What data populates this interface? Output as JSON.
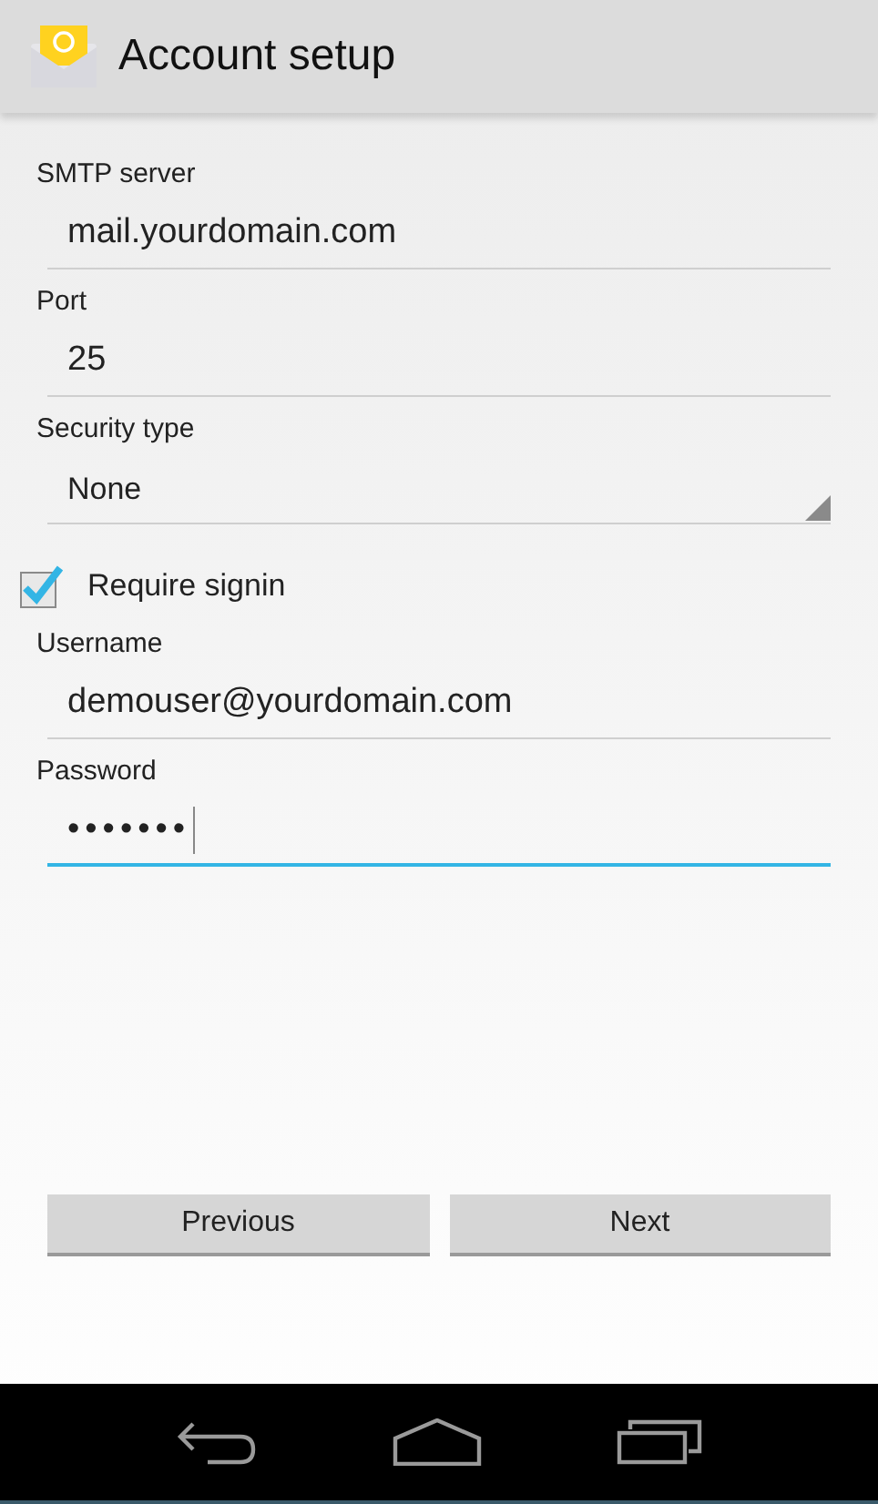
{
  "action_bar": {
    "title": "Account setup"
  },
  "fields": [
    {
      "kind": "text",
      "label": "SMTP server",
      "value": "mail.yourdomain.com",
      "focused": false
    },
    {
      "kind": "text",
      "label": "Port",
      "value": "25",
      "focused": false
    },
    {
      "kind": "select",
      "label": "Security type",
      "value": "None",
      "focused": false
    },
    {
      "kind": "checkbox",
      "label": "Require signin",
      "checked": true
    },
    {
      "kind": "text",
      "label": "Username",
      "value": "demouser@yourdomain.com",
      "focused": false
    },
    {
      "kind": "text",
      "label": "Password",
      "value": "•••••••",
      "focused": true
    }
  ],
  "buttons": [
    "Previous",
    "Next"
  ]
}
